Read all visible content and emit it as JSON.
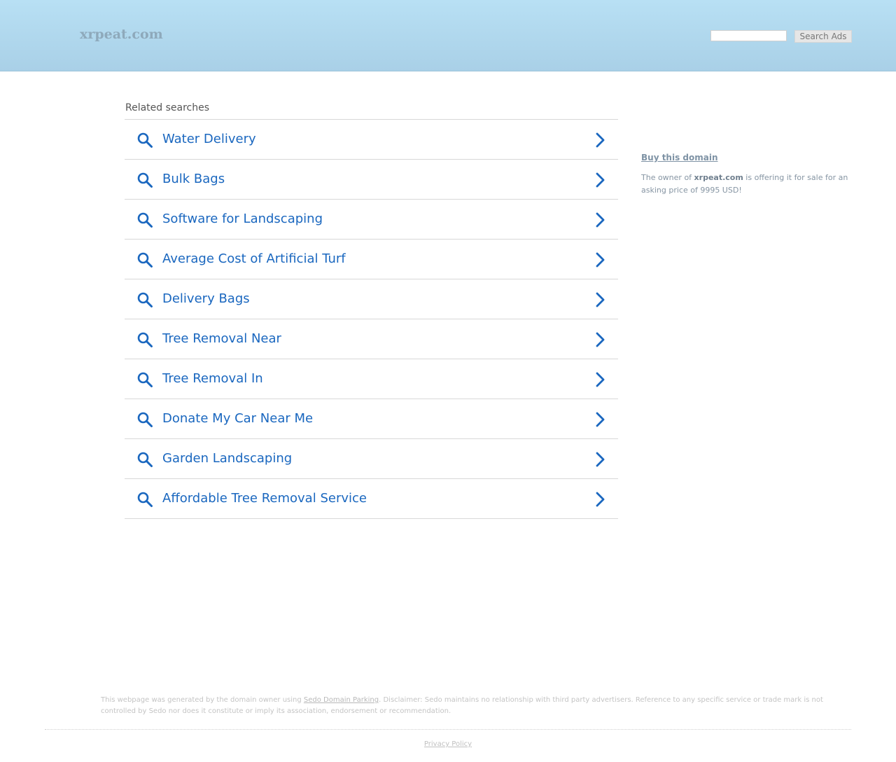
{
  "header": {
    "logo": "xrpeat.com",
    "search_input_value": "",
    "search_button_label": "Search Ads"
  },
  "related": {
    "heading": "Related searches",
    "items": [
      {
        "label": "Water Delivery"
      },
      {
        "label": "Bulk Bags"
      },
      {
        "label": "Software for Landscaping"
      },
      {
        "label": "Average Cost of Artificial Turf"
      },
      {
        "label": "Delivery Bags"
      },
      {
        "label": "Tree Removal Near"
      },
      {
        "label": "Tree Removal In"
      },
      {
        "label": "Donate My Car Near Me"
      },
      {
        "label": "Garden Landscaping"
      },
      {
        "label": "Affordable Tree Removal Service"
      }
    ],
    "icon_search": "search-icon",
    "icon_chevron": "chevron-right-icon",
    "accent_color": "#1a67bf"
  },
  "sidebar": {
    "buy_title": "Buy this domain",
    "text_before": "The owner of ",
    "domain": "xrpeat.com",
    "text_after": " is offering it for sale for an asking price of 9995 USD!"
  },
  "footer": {
    "disclaimer_before": "This webpage was generated by the domain owner using ",
    "disclaimer_link": "Sedo Domain Parking",
    "disclaimer_after": ". Disclaimer: Sedo maintains no relationship with third party advertisers. Reference to any specific service or trade mark is not controlled by Sedo nor does it constitute or imply its association, endorsement or recommendation.",
    "privacy_label": "Privacy Policy"
  }
}
